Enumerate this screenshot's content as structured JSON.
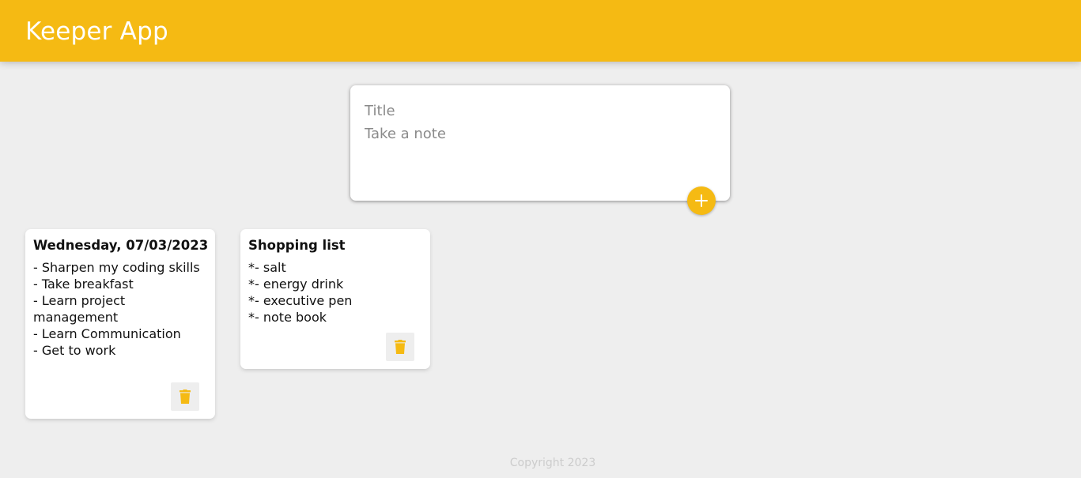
{
  "header": {
    "title": "Keeper App"
  },
  "create_note": {
    "title_placeholder": "Title",
    "content_placeholder": "Take a note",
    "add_icon": "plus-icon"
  },
  "notes": [
    {
      "title": "Wednesday, 07/03/2023",
      "content": "- Sharpen my coding skills\n- Take breakfast\n- Learn project management\n- Learn Communication\n- Get to work",
      "delete_icon": "trash-icon"
    },
    {
      "title": "Shopping list",
      "content": "*- salt\n*- energy drink\n*- executive pen\n*- note book",
      "delete_icon": "trash-icon"
    }
  ],
  "footer": {
    "text": "Copyright 2023"
  },
  "colors": {
    "accent": "#f5ba13",
    "background": "#eeeeee",
    "card": "#ffffff",
    "footer_text": "#cccccc"
  }
}
